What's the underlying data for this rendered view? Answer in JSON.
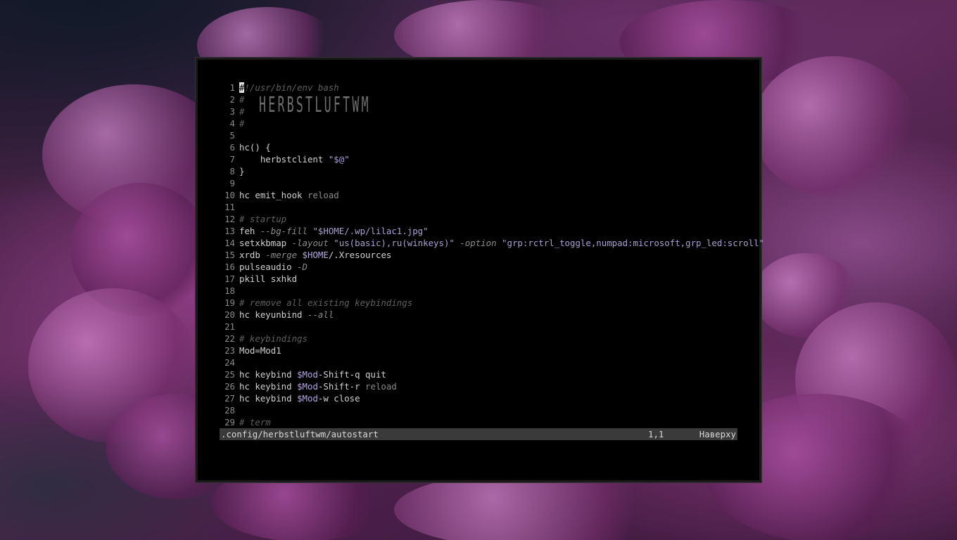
{
  "editor": {
    "lines": [
      {
        "n": "1"
      },
      {
        "n": "2"
      },
      {
        "n": "3"
      },
      {
        "n": "4"
      },
      {
        "n": "5"
      },
      {
        "n": "6"
      },
      {
        "n": "7"
      },
      {
        "n": "8"
      },
      {
        "n": "9"
      },
      {
        "n": "10"
      },
      {
        "n": "11"
      },
      {
        "n": "12"
      },
      {
        "n": "13"
      },
      {
        "n": "14"
      },
      {
        "n": "15"
      },
      {
        "n": "16"
      },
      {
        "n": "17"
      },
      {
        "n": "18"
      },
      {
        "n": "19"
      },
      {
        "n": "20"
      },
      {
        "n": "21"
      },
      {
        "n": "22"
      },
      {
        "n": "23"
      },
      {
        "n": "24"
      },
      {
        "n": "25"
      },
      {
        "n": "26"
      },
      {
        "n": "27"
      },
      {
        "n": "28"
      },
      {
        "n": "29"
      }
    ],
    "code": {
      "l1_cursor": "#",
      "l1_rest": "!/usr/bin/env bash",
      "l2": "#",
      "l3": "#",
      "l3_art": "HERBSTLUFTWM",
      "l4": "#",
      "l6": "hc() {",
      "l7_a": "    herbstclient ",
      "l7_b": "\"$@\"",
      "l8": "}",
      "l10_a": "hc emit_hook ",
      "l10_b": "reload",
      "l12": "# startup",
      "l13_a": "feh ",
      "l13_b": "--bg-fill ",
      "l13_c": "\"$HOME/.wp/lilac1.jpg\"",
      "l14_a": "setxkbmap ",
      "l14_b": "-layout ",
      "l14_c": "\"us(basic),ru(winkeys)\" ",
      "l14_d": "-option ",
      "l14_e": "\"grp:rctrl_toggle,numpad:microsoft,grp_led:scroll\"",
      "l15_a": "xrdb ",
      "l15_b": "-merge ",
      "l15_c": "$HOME",
      "l15_d": "/.Xresources",
      "l16_a": "pulseaudio ",
      "l16_b": "-D",
      "l17": "pkill sxhkd",
      "l19": "# remove all existing keybindings",
      "l20_a": "hc keyunbind ",
      "l20_b": "--all",
      "l22": "# keybindings",
      "l23": "Mod=Mod1",
      "l25_a": "hc keybind ",
      "l25_b": "$Mod",
      "l25_c": "-Shift-q quit",
      "l26_a": "hc keybind ",
      "l26_b": "$Mod",
      "l26_c": "-Shift-r ",
      "l26_d": "reload",
      "l27_a": "hc keybind ",
      "l27_b": "$Mod",
      "l27_c": "-w close",
      "l29": "# term"
    }
  },
  "statusline": {
    "file": ".config/herbstluftwm/autostart",
    "position": "1,1",
    "scroll": "Наверху"
  },
  "colors": {
    "background": "#000000",
    "comment": "#5f5f5f",
    "string": "#a7a0cf",
    "statusline_bg": "#3a3a3a",
    "wallpaper_accent": "#8a3c82"
  }
}
